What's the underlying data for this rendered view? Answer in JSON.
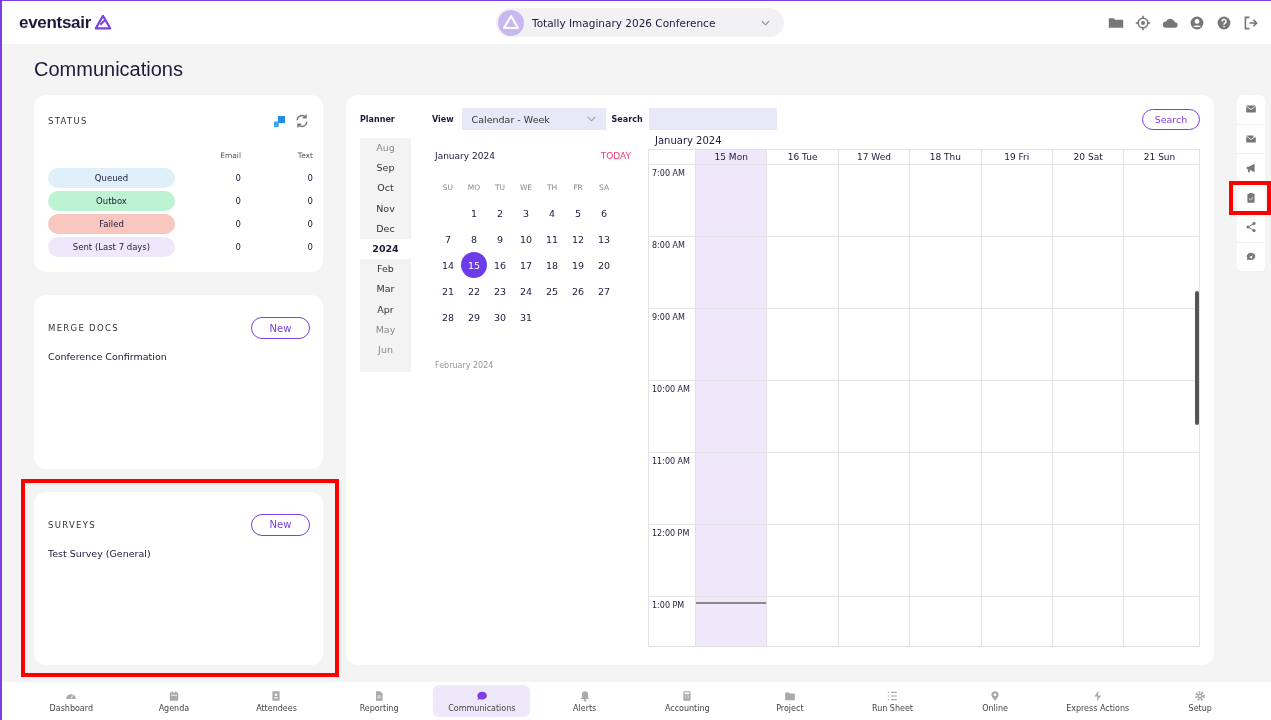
{
  "header": {
    "logo_main": "events",
    "logo_accent": "air",
    "event": "Totally Imaginary 2026 Conference"
  },
  "page_title": "Communications",
  "status": {
    "title": "STATUS",
    "columns": [
      "Email",
      "Text"
    ],
    "rows": [
      {
        "label": "Queued",
        "color": "#dff0fa",
        "email": "0",
        "text": "0"
      },
      {
        "label": "Outbox",
        "color": "#bdf2d3",
        "email": "0",
        "text": "0"
      },
      {
        "label": "Failed",
        "color": "#f9c6c0",
        "email": "0",
        "text": "0"
      },
      {
        "label": "Sent (Last 7 days)",
        "color": "#efe8fb",
        "email": "0",
        "text": "0"
      }
    ]
  },
  "merge_docs": {
    "title": "MERGE DOCS",
    "button": "New",
    "items": [
      "Conference Confirmation"
    ],
    "highlighted": false
  },
  "surveys": {
    "title": "SURVEYS",
    "button": "New",
    "items": [
      "Test Survey (General)"
    ],
    "highlighted": true
  },
  "planner": {
    "label": "Planner",
    "view_label": "View",
    "view_value": "Calendar - Week",
    "search_label": "Search",
    "search_button": "Search",
    "months": [
      {
        "label": "Aug",
        "kind": "month",
        "faded": true
      },
      {
        "label": "Sep",
        "kind": "month",
        "faded": false
      },
      {
        "label": "Oct",
        "kind": "month",
        "faded": false
      },
      {
        "label": "Nov",
        "kind": "month",
        "faded": false
      },
      {
        "label": "Dec",
        "kind": "month",
        "faded": false
      },
      {
        "label": "2024",
        "kind": "year",
        "faded": false
      },
      {
        "label": "Feb",
        "kind": "month",
        "faded": false
      },
      {
        "label": "Mar",
        "kind": "month",
        "faded": false
      },
      {
        "label": "Apr",
        "kind": "month",
        "faded": false
      },
      {
        "label": "May",
        "kind": "month",
        "faded": true
      },
      {
        "label": "Jun",
        "kind": "month",
        "faded": true
      }
    ],
    "mini_calendar": {
      "title": "January 2024",
      "today": "TODAY",
      "weekdays": [
        "SU",
        "MO",
        "TU",
        "WE",
        "TH",
        "FR",
        "SA"
      ],
      "weeks": [
        {
          "kind": "leading",
          "days": [
            {
              "label": "1",
              "selected": false
            },
            {
              "label": "2",
              "selected": false
            },
            {
              "label": "3",
              "selected": false
            },
            {
              "label": "4",
              "selected": false
            },
            {
              "label": "5",
              "selected": false
            },
            {
              "label": "6",
              "selected": false
            }
          ]
        },
        {
          "kind": "regular",
          "days": [
            {
              "label": "7",
              "selected": false
            },
            {
              "label": "8",
              "selected": false
            },
            {
              "label": "9",
              "selected": false
            },
            {
              "label": "10",
              "selected": false
            },
            {
              "label": "11",
              "selected": false
            },
            {
              "label": "12",
              "selected": false
            },
            {
              "label": "13",
              "selected": false
            }
          ]
        },
        {
          "kind": "regular",
          "days": [
            {
              "label": "14",
              "selected": false
            },
            {
              "label": "15",
              "selected": true
            },
            {
              "label": "16",
              "selected": false
            },
            {
              "label": "17",
              "selected": false
            },
            {
              "label": "18",
              "selected": false
            },
            {
              "label": "19",
              "selected": false
            },
            {
              "label": "20",
              "selected": false
            }
          ]
        },
        {
          "kind": "regular",
          "days": [
            {
              "label": "21",
              "selected": false
            },
            {
              "label": "22",
              "selected": false
            },
            {
              "label": "23",
              "selected": false
            },
            {
              "label": "24",
              "selected": false
            },
            {
              "label": "25",
              "selected": false
            },
            {
              "label": "26",
              "selected": false
            },
            {
              "label": "27",
              "selected": false
            }
          ]
        },
        {
          "kind": "regular",
          "days": [
            {
              "label": "28",
              "selected": false
            },
            {
              "label": "29",
              "selected": false
            },
            {
              "label": "30",
              "selected": false
            },
            {
              "label": "31",
              "selected": false
            }
          ]
        }
      ],
      "next_month": "February 2024"
    },
    "week": {
      "title": "January 2024",
      "days": [
        {
          "label": "15 Mon",
          "selected": true
        },
        {
          "label": "16 Tue",
          "selected": false
        },
        {
          "label": "17 Wed",
          "selected": false
        },
        {
          "label": "18 Thu",
          "selected": false
        },
        {
          "label": "19 Fri",
          "selected": false
        },
        {
          "label": "20 Sat",
          "selected": false
        },
        {
          "label": "21 Sun",
          "selected": false
        }
      ],
      "times": [
        {
          "label": "7:00 AM",
          "now": false
        },
        {
          "label": "8:00 AM",
          "now": false
        },
        {
          "label": "9:00 AM",
          "now": false
        },
        {
          "label": "10:00 AM",
          "now": false
        },
        {
          "label": "11:00 AM",
          "now": false
        },
        {
          "label": "12:00 PM",
          "now": false
        },
        {
          "label": "1:00 PM",
          "now": true
        }
      ]
    }
  },
  "side_tools": [
    {
      "highlighted": false
    },
    {
      "highlighted": false
    },
    {
      "highlighted": false
    },
    {
      "highlighted": true
    },
    {
      "highlighted": false
    },
    {
      "highlighted": false
    }
  ],
  "bottom_nav": [
    {
      "label": "Dashboard",
      "selected": false
    },
    {
      "label": "Agenda",
      "selected": false
    },
    {
      "label": "Attendees",
      "selected": false
    },
    {
      "label": "Reporting",
      "selected": false
    },
    {
      "label": "Communications",
      "selected": true
    },
    {
      "label": "Alerts",
      "selected": false
    },
    {
      "label": "Accounting",
      "selected": false
    },
    {
      "label": "Project",
      "selected": false
    },
    {
      "label": "Run Sheet",
      "selected": false
    },
    {
      "label": "Online",
      "selected": false
    },
    {
      "label": "Express Actions",
      "selected": false
    },
    {
      "label": "Setup",
      "selected": false
    }
  ]
}
